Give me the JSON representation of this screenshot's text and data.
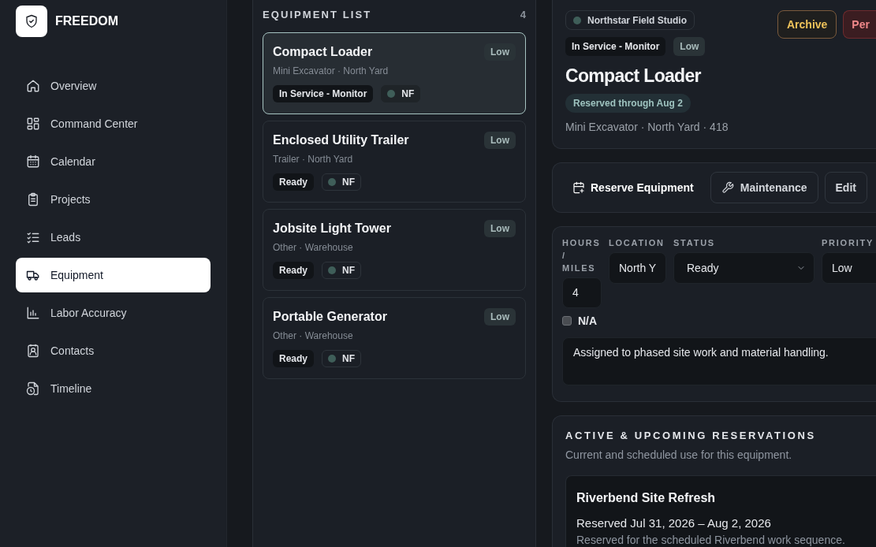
{
  "brand": {
    "name": "FREEDOM"
  },
  "sidebar": {
    "items": [
      {
        "label": "Overview",
        "selected": false
      },
      {
        "label": "Command Center",
        "selected": false
      },
      {
        "label": "Calendar",
        "selected": false
      },
      {
        "label": "Projects",
        "selected": false
      },
      {
        "label": "Leads",
        "selected": false
      },
      {
        "label": "Equipment",
        "selected": true
      },
      {
        "label": "Labor Accuracy",
        "selected": false
      },
      {
        "label": "Contacts",
        "selected": false
      },
      {
        "label": "Timeline",
        "selected": false
      }
    ]
  },
  "equipment_list": {
    "title": "EQUIPMENT LIST",
    "count": "4",
    "items": [
      {
        "name": "Compact Loader",
        "subtitle": "Mini Excavator · North Yard",
        "status": "In Service - Monitor",
        "tag": "NF",
        "priority": "Low",
        "selected": true
      },
      {
        "name": "Enclosed Utility Trailer",
        "subtitle": "Trailer · North Yard",
        "status": "Ready",
        "tag": "NF",
        "priority": "Low",
        "selected": false
      },
      {
        "name": "Jobsite Light Tower",
        "subtitle": "Other · Warehouse",
        "status": "Ready",
        "tag": "NF",
        "priority": "Low",
        "selected": false
      },
      {
        "name": "Portable Generator",
        "subtitle": "Other · Warehouse",
        "status": "Ready",
        "tag": "NF",
        "priority": "Low",
        "selected": false
      }
    ]
  },
  "detail": {
    "org": "Northstar Field Studio",
    "buttons": [
      {
        "label": "Archive",
        "kind": "warning"
      },
      {
        "label": "Per",
        "kind": "danger"
      }
    ],
    "status": "In Service - Monitor",
    "priority": "Low",
    "title": "Compact Loader",
    "reservation_badge": "Reserved through Aug 2",
    "meta": "Mini Excavator · North Yard · 418"
  },
  "actions": [
    {
      "label": "Reserve Equipment",
      "kind": "primary"
    },
    {
      "label": "Maintenance",
      "kind": "outline"
    },
    {
      "label": "Edit",
      "kind": "outline"
    }
  ],
  "form": {
    "fields": [
      {
        "label": "HOURS / MILES",
        "value": "4",
        "kind": "input"
      },
      {
        "label": "LOCATION",
        "value": "North Y",
        "kind": "input"
      },
      {
        "label": "STATUS",
        "value": "Ready",
        "kind": "select"
      },
      {
        "label": "PRIORITY",
        "value": "Low",
        "kind": "input"
      }
    ],
    "na": {
      "label": "N/A",
      "checked": false
    },
    "notes": "Assigned to phased site work and material handling."
  },
  "reservations": {
    "title": "ACTIVE & UPCOMING RESERVATIONS",
    "subtitle": "Current and scheduled use for this equipment.",
    "items": [
      {
        "name": "Riverbend Site Refresh",
        "dates": "Reserved Jul 31, 2026 – Aug 2, 2026",
        "note": "Reserved for the scheduled Riverbend work sequence."
      }
    ]
  }
}
